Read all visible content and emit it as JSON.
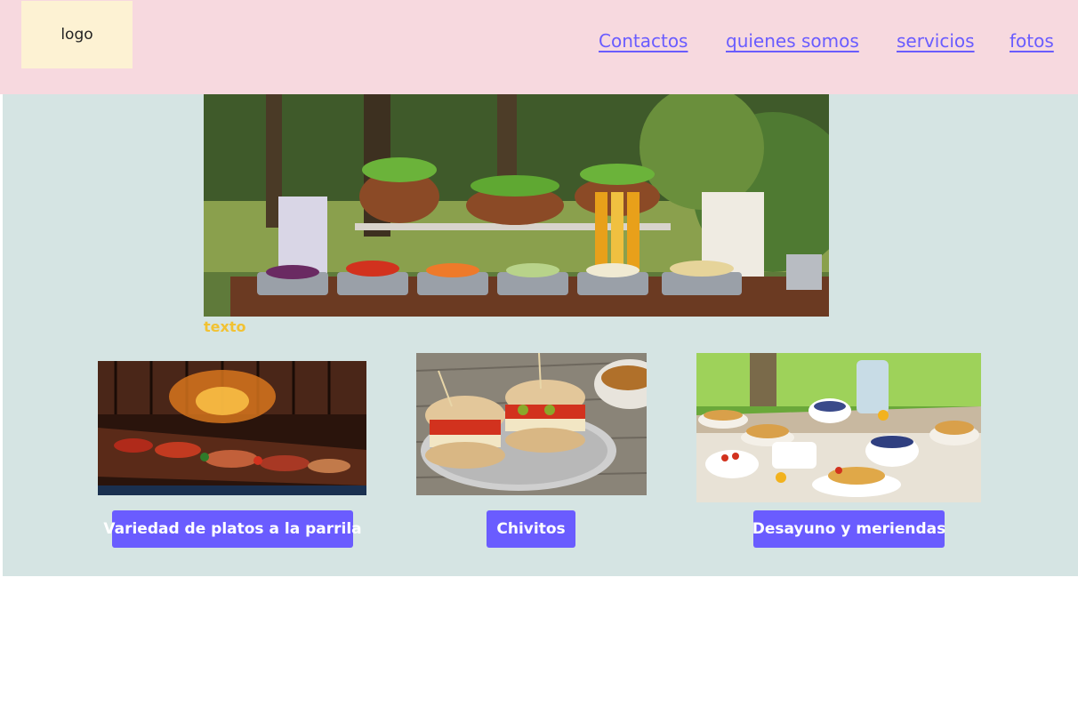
{
  "header": {
    "logo_text": "logo",
    "nav": [
      {
        "label": "Contactos"
      },
      {
        "label": "quienes somos"
      },
      {
        "label": "servicios"
      },
      {
        "label": "fotos"
      }
    ]
  },
  "hero": {
    "caption": "texto"
  },
  "cards": [
    {
      "button_label": "Variedad de platos a la parrila"
    },
    {
      "button_label": "Chivitos"
    },
    {
      "button_label": "Desayuno y meriendas"
    }
  ],
  "colors": {
    "header_bg": "#f7d9df",
    "logo_bg": "#fdf2d3",
    "main_bg": "#d5e4e3",
    "accent": "#6a5cff",
    "caption": "#f2c232"
  }
}
